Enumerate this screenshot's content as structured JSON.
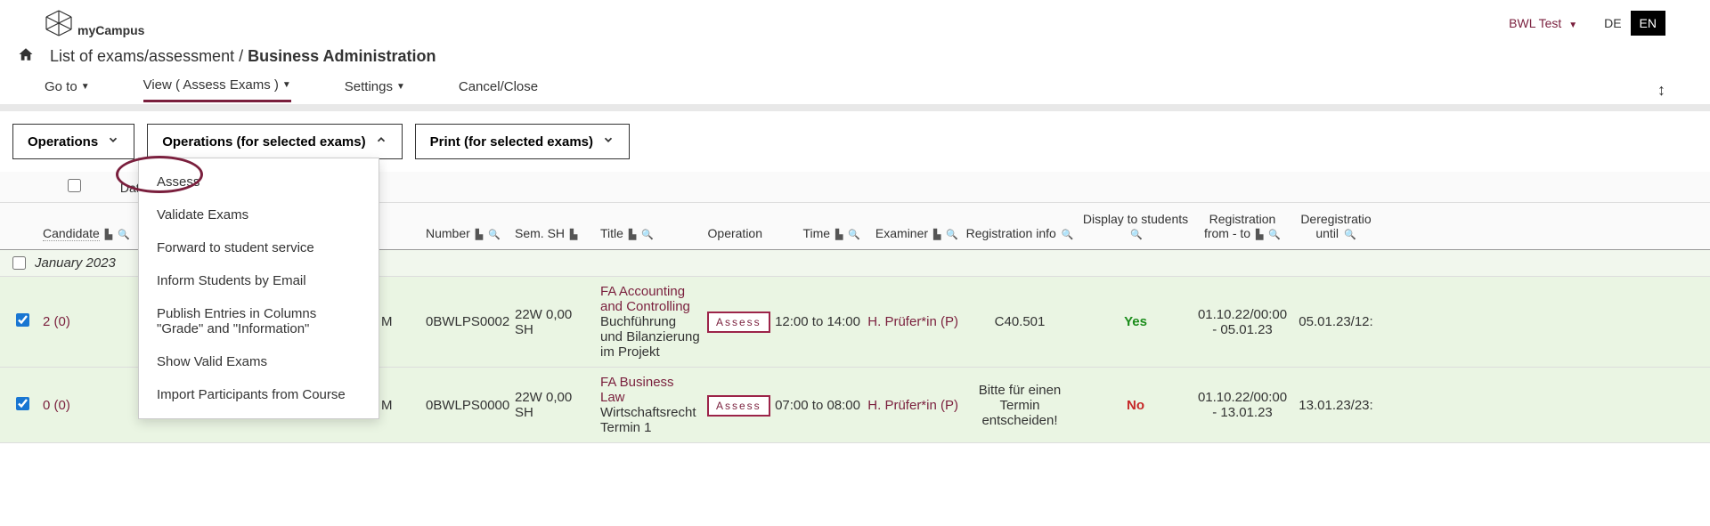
{
  "header": {
    "logo_text": "myCampus",
    "user": "BWL Test",
    "lang_de": "DE",
    "lang_en": "EN"
  },
  "breadcrumb": {
    "path": "List of exams/assessment  /",
    "current": "Business Administration"
  },
  "menu": {
    "goto": "Go to",
    "view": "View ( Assess Exams )",
    "settings": "Settings",
    "cancel": "Cancel/Close"
  },
  "actions": {
    "operations": "Operations",
    "operations_selected": "Operations (for selected exams)",
    "print_selected": "Print (for selected exams)"
  },
  "dropdown": {
    "items": [
      "Assess",
      "Validate Exams",
      "Forward to student service",
      "Inform Students by Email",
      "Publish Entries in Columns \"Grade\" and \"Information\"",
      "Show Valid Exams",
      "Import Participants from Course"
    ]
  },
  "table": {
    "date_header": "Date",
    "columns": {
      "candidates": "Candidate",
      "m": "",
      "number": "Number",
      "sem": "Sem. SH",
      "title": "Title",
      "operation": "Operation",
      "time": "Time",
      "examiner": "Examiner",
      "reginfo": "Registration info",
      "display": "Display to students",
      "regperiod": "Registration from - to",
      "dereg": "Deregistratio until"
    },
    "group": "January 2023",
    "rows": [
      {
        "candidates": "2 (0)",
        "m": "M",
        "number": "0BWLPS0002",
        "sem": "22W 0,00 SH",
        "title_main": "FA Accounting and Controlling",
        "title_sub": "Buchführung und Bilanzierung im Projekt",
        "operation": "Assess",
        "time": "12:00 to 14:00",
        "examiner": "H. Prüfer*in (P)",
        "reginfo": "C40.501",
        "display": "Yes",
        "regperiod": "01.10.22/00:00 - 05.01.23",
        "dereg": "05.01.23/12:"
      },
      {
        "candidates": "0 (0)",
        "m": "M",
        "number": "0BWLPS0000",
        "sem": "22W 0,00 SH",
        "title_main": "FA Business Law",
        "title_sub": "Wirtschaftsrecht Termin 1",
        "operation": "Assess",
        "time": "07:00 to 08:00",
        "examiner": "H. Prüfer*in (P)",
        "reginfo": "Bitte für einen Termin entscheiden!",
        "display": "No",
        "regperiod": "01.10.22/00:00 - 13.01.23",
        "dereg": "13.01.23/23:"
      }
    ]
  }
}
